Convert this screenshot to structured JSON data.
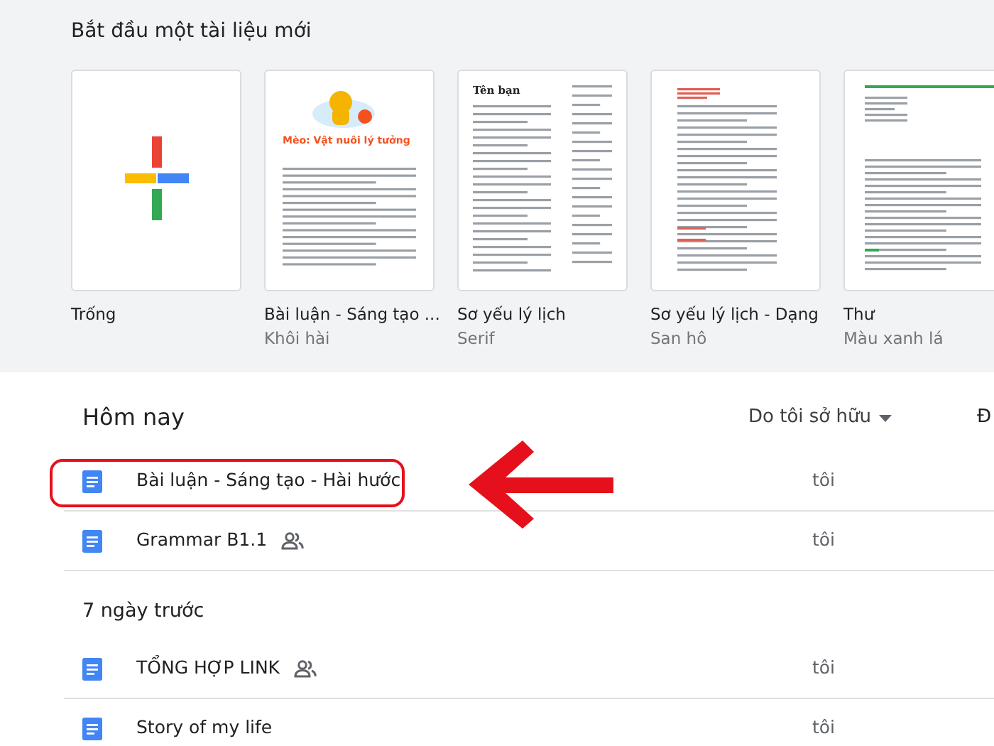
{
  "templates_section": {
    "title": "Bắt đầu một tài liệu mới",
    "templates": [
      {
        "kind": "blank",
        "name": "Trống"
      },
      {
        "kind": "essay",
        "name": "Bài luận - Sáng tạo ...",
        "subtitle": "Khôi hài",
        "heading": "Mèo: Vật nuôi lý tưởng"
      },
      {
        "kind": "resume",
        "name": "Sơ yếu lý lịch",
        "subtitle": "Serif",
        "heading": "Tên bạn"
      },
      {
        "kind": "resume_coral",
        "name": "Sơ yếu lý lịch - Dạng",
        "subtitle": "San hô"
      },
      {
        "kind": "letter",
        "name": "Thư",
        "subtitle": "Màu xanh lá"
      }
    ]
  },
  "documents": {
    "owner_filter": "Do tôi sở hữu",
    "column_3": "Đ",
    "groups": [
      {
        "title": "Hôm nay",
        "rows": [
          {
            "name": "Bài luận - Sáng tạo - Hài hước",
            "shared": false,
            "owner": "tôi",
            "highlighted": true
          },
          {
            "name": "Grammar B1.1",
            "shared": true,
            "owner": "tôi",
            "highlighted": false
          }
        ]
      },
      {
        "title": "7 ngày trước",
        "rows": [
          {
            "name": "TỔNG HỢP LINK",
            "shared": true,
            "owner": "tôi",
            "highlighted": false
          },
          {
            "name": "Story of my life",
            "shared": false,
            "owner": "tôi",
            "highlighted": false
          }
        ]
      }
    ]
  },
  "callout_arrow": true
}
